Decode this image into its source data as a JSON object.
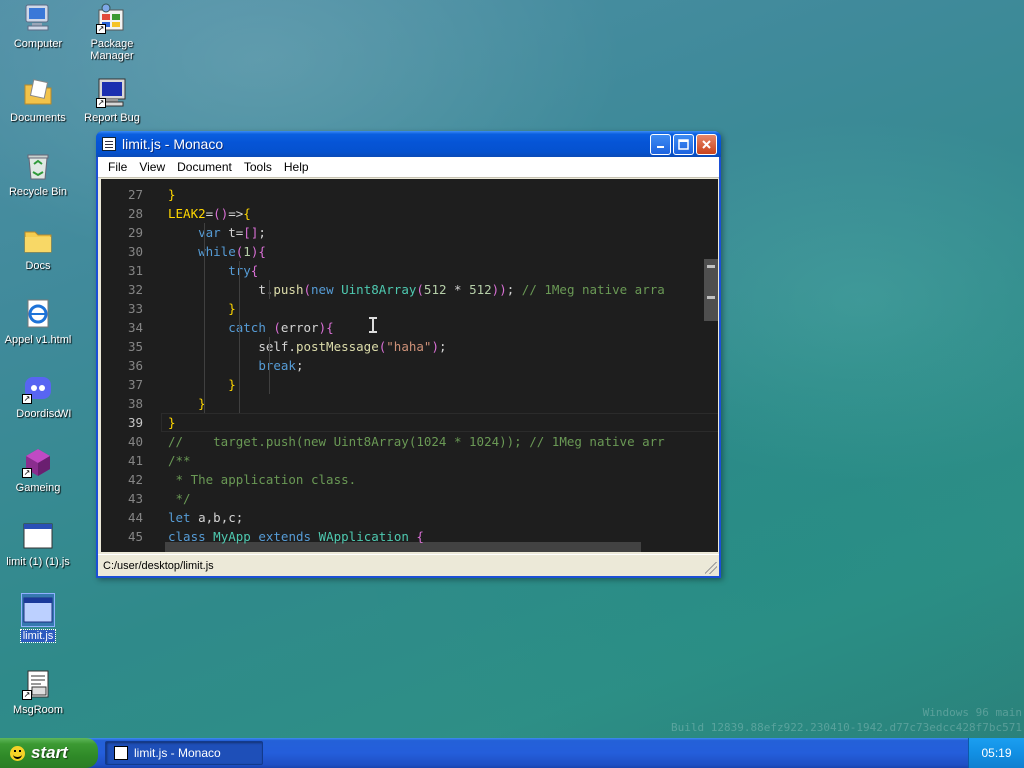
{
  "desktop": {
    "icons": [
      {
        "label": "Computer",
        "icon": "computer-icon"
      },
      {
        "label": "Package Manager",
        "icon": "package-manager-icon"
      },
      {
        "label": "Documents",
        "icon": "documents-folder-icon"
      },
      {
        "label": "Report Bug",
        "icon": "report-bug-icon"
      },
      {
        "label": "Recycle Bin",
        "icon": "recycle-bin-icon"
      },
      {
        "label": "Docs",
        "icon": "folder-icon"
      },
      {
        "label": "Appel v1.html",
        "icon": "html-file-icon"
      },
      {
        "label": "Doordisc",
        "icon": "doordisc-icon"
      },
      {
        "label": "WI",
        "icon": "partial-label"
      },
      {
        "label": "Gameing",
        "icon": "cube-icon"
      },
      {
        "label": "limit (1) (1).js",
        "icon": "window-file-icon"
      },
      {
        "label": "limit.js",
        "icon": "window-file-icon"
      },
      {
        "label": "MsgRoom",
        "icon": "msgroom-icon"
      }
    ],
    "watermark": {
      "line1": "Windows 96 main",
      "line2": "Build 12839.88efz922.230410-1942.d77c73edcc428f7bc571"
    }
  },
  "window": {
    "title": "limit.js - Monaco",
    "menu": [
      "File",
      "View",
      "Document",
      "Tools",
      "Help"
    ],
    "status_path": "C:/user/desktop/limit.js",
    "current_line": 39,
    "code_lines": [
      {
        "n": "27",
        "text": "}"
      },
      {
        "n": "28",
        "text": "LEAK2=()=>{"
      },
      {
        "n": "29",
        "text": "    var t=[];"
      },
      {
        "n": "30",
        "text": "    while(1){"
      },
      {
        "n": "31",
        "text": "        try{"
      },
      {
        "n": "32",
        "text": "            t.push(new Uint8Array(512 * 512)); // 1Meg native arra"
      },
      {
        "n": "33",
        "text": "        }"
      },
      {
        "n": "34",
        "text": "        catch (error){"
      },
      {
        "n": "35",
        "text": "            self.postMessage(\"haha\");"
      },
      {
        "n": "36",
        "text": "            break;"
      },
      {
        "n": "37",
        "text": "        }"
      },
      {
        "n": "38",
        "text": "    }"
      },
      {
        "n": "39",
        "text": "}"
      },
      {
        "n": "40",
        "text": "//    target.push(new Uint8Array(1024 * 1024)); // 1Meg native arr"
      },
      {
        "n": "41",
        "text": "/**"
      },
      {
        "n": "42",
        "text": " * The application class."
      },
      {
        "n": "43",
        "text": " */"
      },
      {
        "n": "44",
        "text": "let a,b,c;"
      },
      {
        "n": "45",
        "text": "class MyApp extends WApplication {"
      }
    ]
  },
  "taskbar": {
    "start_label": "start",
    "task_label": "limit.js - Monaco",
    "clock": "05:19"
  },
  "colors": {
    "editor_bg": "#1e1e1e",
    "titlebar_blue": "#0654d6",
    "start_green": "#2f8a28"
  }
}
